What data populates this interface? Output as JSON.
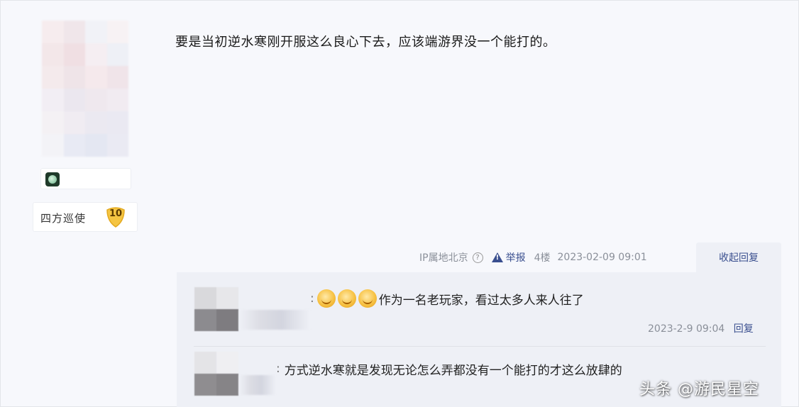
{
  "post": {
    "text": "要是当初逆水寒刚开服这么良心下去，应该端游界没一个能打的。",
    "author_badge": "四方巡使",
    "level": "10",
    "ip_location": "IP属地北京",
    "report_label": "举报",
    "floor": "4楼",
    "timestamp": "2023-02-09 09:01",
    "collapse_label": "收起回复"
  },
  "replies": [
    {
      "prefix": ":",
      "text": "作为一名老玩家，看过太多人来人往了",
      "emoji_icons": [
        "smiley-icon",
        "smiley-icon",
        "smiley-icon"
      ],
      "timestamp": "2023-2-9 09:04",
      "reply_label": "回复"
    },
    {
      "prefix": ":",
      "text": "方式逆水寒就是发现无论怎么弄都没有一个能打的才这么放肆的"
    }
  ],
  "watermark": "头条 @游民星空",
  "colors": {
    "background": "#f7f8fc",
    "reply_panel": "#eef0f6",
    "link": "#3a4f8f",
    "meta": "#8a8f99",
    "level_badge": "#f5c542"
  }
}
